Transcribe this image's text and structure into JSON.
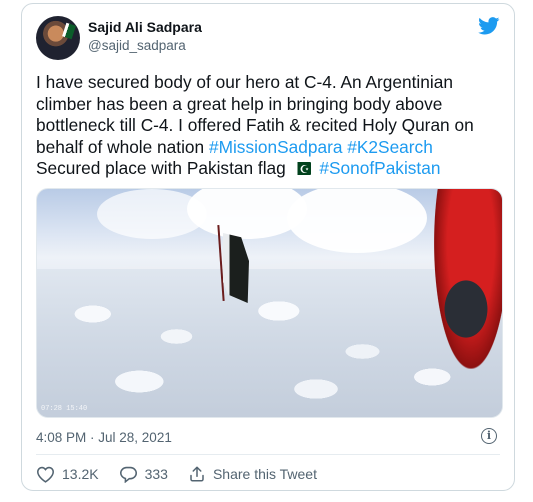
{
  "tweet": {
    "author_name": "Sajid Ali Sadpara",
    "handle": "@sajid_sadpara",
    "text_lines": [
      "I have secured body of our hero at C-4. An Argentinian",
      "climber has been a great help in bringing body above",
      "bottleneck till C-4. I offered Fatih & recited Holy Quran on"
    ],
    "line4_prefix": "behalf of whole nation ",
    "hashtag_mission": "#MissionSadpara",
    "hashtag_k2": "#K2Search",
    "line5_text": "Secured place with Pakistan flag",
    "hashtag_son": "#SonofPakistan",
    "video_timestamp": "07:28 15:40",
    "timestamp": "4:08 PM · Jul 28, 2021",
    "info_glyph": "i",
    "likes": "13.2K",
    "replies": "333",
    "share_label": "Share this Tweet"
  },
  "colors": {
    "link": "#1d9bf0",
    "twitter_blue": "#1d9bf0",
    "secondary_text": "#536471",
    "pakistan_green": "#01411c"
  },
  "icons": {
    "logo": "twitter-bird-icon",
    "like": "heart-icon",
    "reply": "reply-bubble-icon",
    "share": "share-icon",
    "info": "info-icon",
    "emoji": "pakistan-flag-icon"
  }
}
